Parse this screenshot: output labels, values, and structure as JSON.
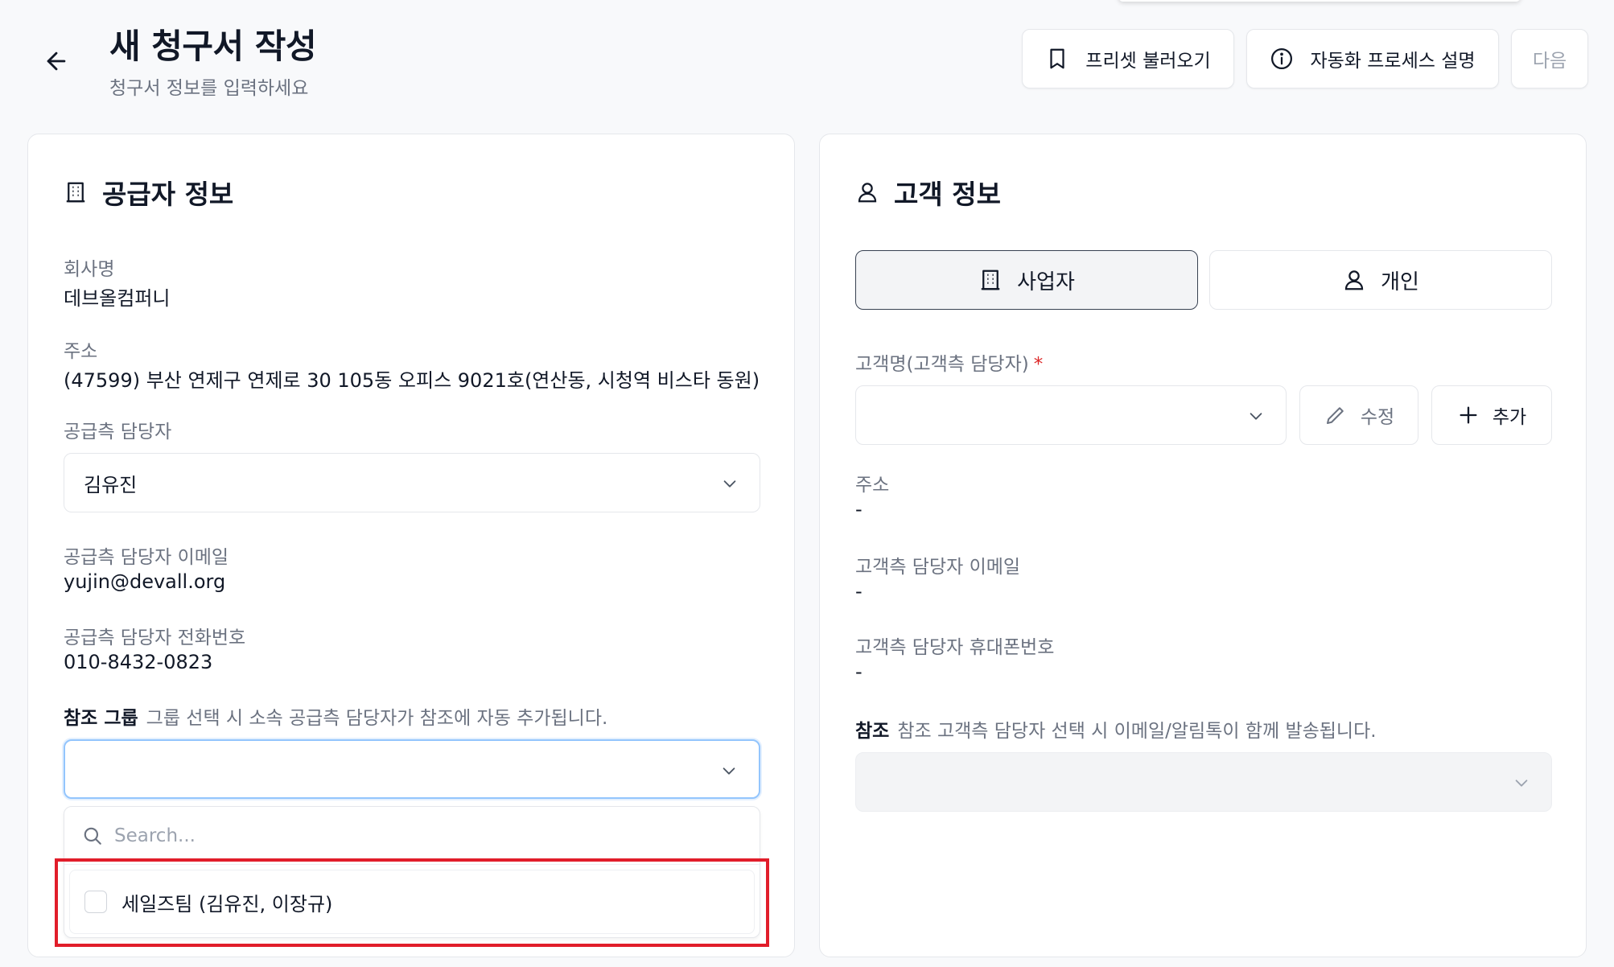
{
  "header": {
    "title": "새 청구서 작성",
    "subtitle": "청구서 정보를 입력하세요",
    "preset_label": "프리셋 불러오기",
    "process_label": "자동화 프로세스 설명",
    "next_label": "다음"
  },
  "supplier": {
    "title": "공급자 정보",
    "company_label": "회사명",
    "company_value": "데브올컴퍼니",
    "address_label": "주소",
    "address_value": "(47599) 부산 연제구 연제로 30 105동 오피스 9021호(연산동, 시청역 비스타 동원)",
    "manager_label": "공급측 담당자",
    "manager_value": "김유진",
    "email_label": "공급측 담당자 이메일",
    "email_value": "yujin@devall.org",
    "phone_label": "공급측 담당자 전화번호",
    "phone_value": "010-8432-0823",
    "ref_group_label": "참조 그룹",
    "ref_group_hint": "그룹 선택 시 소속 공급측 담당자가 참조에 자동 추가됩니다.",
    "ref_group_value": "",
    "search_placeholder": "Search...",
    "options": [
      {
        "label": "세일즈팀 (김유진, 이장규)",
        "checked": false
      }
    ]
  },
  "customer": {
    "title": "고객 정보",
    "type_business": "사업자",
    "type_individual": "개인",
    "selected_type": "business",
    "name_label": "고객명(고객측 담당자)",
    "required_mark": "*",
    "name_value": "",
    "edit_label": "수정",
    "add_label": "추가",
    "address_label": "주소",
    "address_value": "-",
    "email_label": "고객측 담당자 이메일",
    "email_value": "-",
    "phone_label": "고객측 담당자 휴대폰번호",
    "phone_value": "-",
    "ref_label": "참조",
    "ref_hint": "참조 고객측 담당자 선택 시 이메일/알림톡이 함께 발송됩니다.",
    "ref_value": ""
  },
  "colors": {
    "highlight": "#e11d2a",
    "focus_ring": "#93c5fd",
    "required": "#dc2626"
  }
}
